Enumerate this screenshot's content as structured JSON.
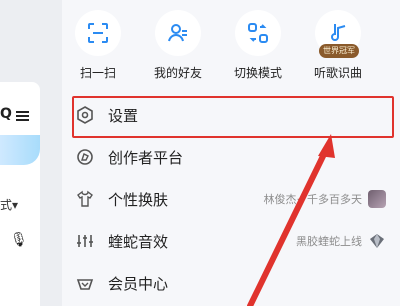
{
  "background": {
    "truncated_text": "式",
    "icons": [
      "search-icon",
      "menu-icon",
      "mic-icon"
    ]
  },
  "quick_actions": [
    {
      "label": "扫一扫",
      "icon": "scan-icon"
    },
    {
      "label": "我的好友",
      "icon": "friends-icon"
    },
    {
      "label": "切换模式",
      "icon": "switch-mode-icon"
    },
    {
      "label": "听歌识曲",
      "icon": "music-recognition-icon",
      "badge": "世界冠军"
    }
  ],
  "menu": {
    "items": [
      {
        "label": "设置",
        "icon": "settings-icon",
        "highlighted": true
      },
      {
        "label": "创作者平台",
        "icon": "creator-icon"
      },
      {
        "label": "个性换肤",
        "icon": "skin-icon",
        "extra": "林俊杰·7千多百多天"
      },
      {
        "label": "蝰蛇音效",
        "icon": "sound-effect-icon",
        "extra": "黑胶蝰蛇上线"
      },
      {
        "label": "会员中心",
        "icon": "vip-icon"
      }
    ]
  },
  "annotation": {
    "highlight_color": "#e0332d"
  }
}
